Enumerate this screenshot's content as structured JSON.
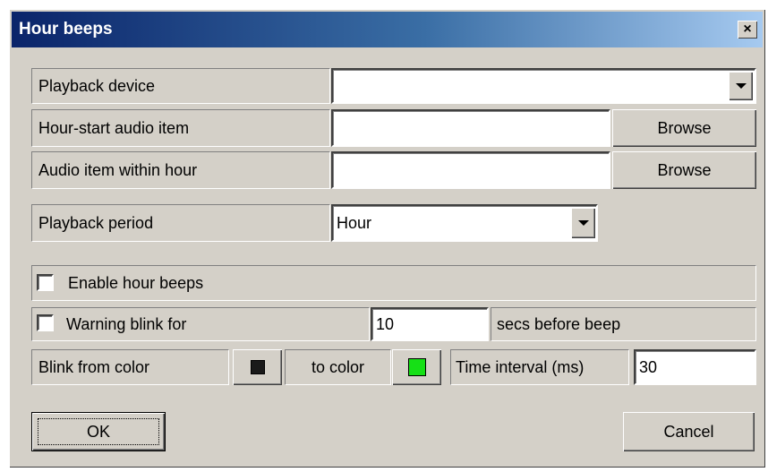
{
  "window": {
    "title": "Hour beeps",
    "close_label": "×"
  },
  "rows": {
    "playback_device": {
      "label": "Playback device",
      "value": ""
    },
    "hour_start": {
      "label": "Hour-start audio item",
      "value": "",
      "browse_label": "Browse"
    },
    "within_hour": {
      "label": "Audio item within hour",
      "value": "",
      "browse_label": "Browse"
    },
    "playback_period": {
      "label": "Playback period",
      "value": "Hour"
    }
  },
  "enable_beeps": {
    "label": "Enable hour beeps",
    "checked": false
  },
  "warning": {
    "label": "Warning blink for",
    "checked": false,
    "value": "10",
    "suffix": "secs before beep"
  },
  "blink": {
    "from_label": "Blink from color",
    "from_color": "#1a1a1a",
    "to_label": "to color",
    "to_color": "#16e016",
    "interval_label": "Time interval (ms)",
    "interval_value": "30"
  },
  "buttons": {
    "ok": "OK",
    "cancel": "Cancel"
  }
}
